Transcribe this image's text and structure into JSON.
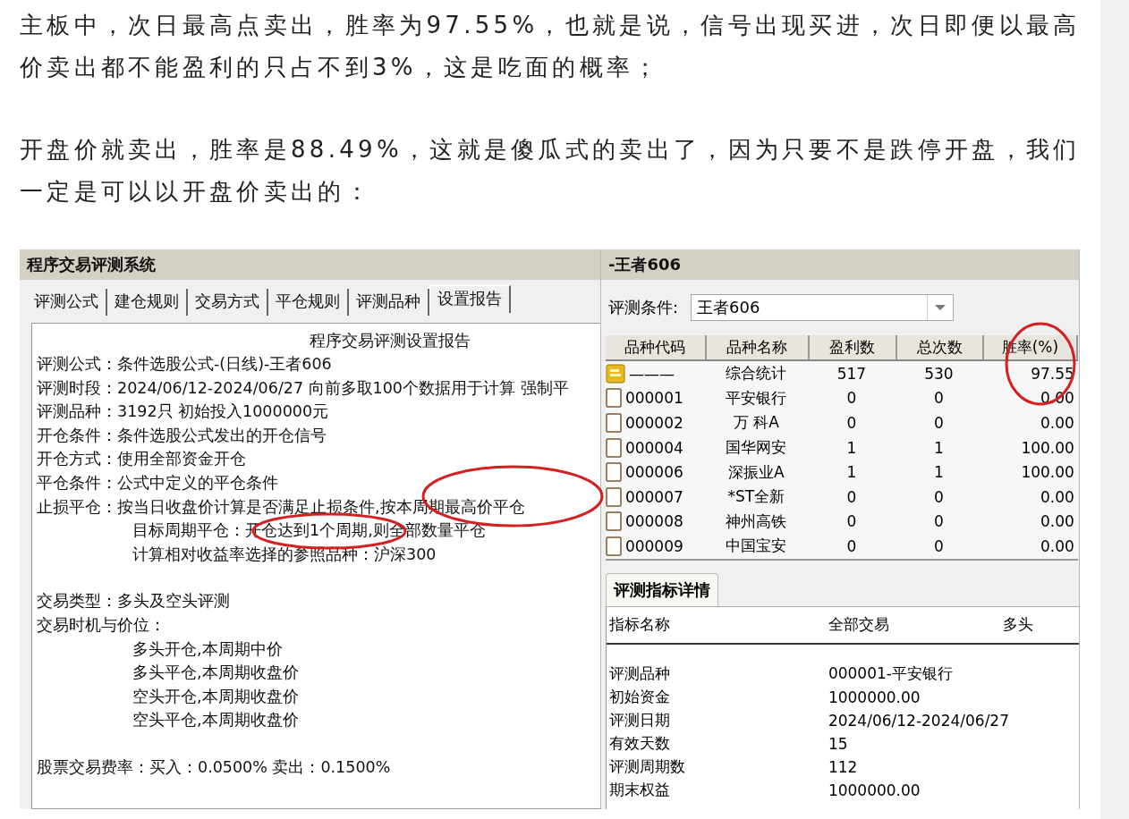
{
  "article": {
    "paragraphs": [
      "主板中，次日最高点卖出，胜率为97.55%，也就是说，信号出现买进，次日即便以最高价卖出都不能盈利的只占不到3%，这是吃面的概率；",
      "开盘价就卖出，胜率是88.49%，这就是傻瓜式的卖出了，因为只要不是跌停开盘，我们一定是可以以开盘价卖出的："
    ]
  },
  "left_window": {
    "title": "程序交易评测系统",
    "tabs": [
      {
        "label": "评测公式",
        "selected": false
      },
      {
        "label": "建仓规则",
        "selected": false
      },
      {
        "label": "交易方式",
        "selected": false
      },
      {
        "label": "平仓规则",
        "selected": false
      },
      {
        "label": "评测品种",
        "selected": false
      },
      {
        "label": "设置报告",
        "selected": true
      }
    ],
    "report": {
      "title": "程序交易评测设置报告",
      "sections": [
        [
          {
            "kind": "plain",
            "text": "评测公式：条件选股公式-(日线)-王者606"
          },
          {
            "kind": "plain",
            "text": "评测时段：2024/06/12-2024/06/27 向前多取100个数据用于计算 强制平"
          },
          {
            "kind": "plain",
            "text": "评测品种：3192只 初始投入1000000元"
          },
          {
            "kind": "plain",
            "text": "开仓条件：条件选股公式发出的开仓信号"
          },
          {
            "kind": "plain",
            "text": "开仓方式：使用全部资金开仓"
          },
          {
            "kind": "plain",
            "text": "平仓条件：公式中定义的平仓条件"
          },
          {
            "kind": "plain",
            "text": "止损平仓：按当日收盘价计算是否满足止损条件,按本周期最高价平仓"
          },
          {
            "kind": "indented",
            "text": "目标周期平仓：开仓达到1个周期,则全部数量平仓"
          },
          {
            "kind": "indented",
            "text": "计算相对收益率选择的参照品种：沪深300"
          }
        ],
        [
          {
            "kind": "plain",
            "text": "交易类型：多头及空头评测"
          },
          {
            "kind": "plain",
            "text": "交易时机与价位："
          },
          {
            "kind": "indented",
            "text": "多头开仓,本周期中价"
          },
          {
            "kind": "indented",
            "text": "多头平仓,本周期收盘价"
          },
          {
            "kind": "indented",
            "text": "空头开仓,本周期收盘价"
          },
          {
            "kind": "indented",
            "text": "空头平仓,本周期收盘价"
          }
        ],
        [
          {
            "kind": "plain",
            "text": "股票交易费率：买入：0.0500%  卖出：0.1500%"
          }
        ]
      ]
    }
  },
  "right_window": {
    "title": "-王者606",
    "condition_label": "评测条件:",
    "condition_value": "王者606",
    "columns": [
      "品种代码",
      "品种名称",
      "盈利数",
      "总次数",
      "胜率(%)"
    ],
    "rows": [
      {
        "kind": "summary",
        "cells": [
          "———",
          "综合统计",
          "517",
          "530",
          "97.55"
        ]
      },
      {
        "kind": "stock",
        "cells": [
          "000001",
          "平安银行",
          "0",
          "0",
          "0.00"
        ]
      },
      {
        "kind": "stock",
        "cells": [
          "000002",
          "万 科A",
          "0",
          "0",
          "0.00"
        ]
      },
      {
        "kind": "stock",
        "cells": [
          "000004",
          "国华网安",
          "1",
          "1",
          "100.00"
        ]
      },
      {
        "kind": "stock",
        "cells": [
          "000006",
          "深振业A",
          "1",
          "1",
          "100.00"
        ]
      },
      {
        "kind": "stock",
        "cells": [
          "000007",
          "*ST全新",
          "0",
          "0",
          "0.00"
        ]
      },
      {
        "kind": "stock",
        "cells": [
          "000008",
          "神州高铁",
          "0",
          "0",
          "0.00"
        ]
      },
      {
        "kind": "stock",
        "cells": [
          "000009",
          "中国宝安",
          "0",
          "0",
          "0.00"
        ]
      }
    ],
    "detail_tab": "评测指标详情",
    "detail_columns": [
      "指标名称",
      "全部交易",
      "多头"
    ],
    "detail_rows": [
      [
        "评测品种",
        "000001-平安银行"
      ],
      [
        "初始资金",
        "1000000.00"
      ],
      [
        "评测日期",
        "2024/06/12-2024/06/27"
      ],
      [
        "有效天数",
        "15"
      ],
      [
        "评测周期数",
        "112"
      ],
      [
        "期末权益",
        "1000000.00"
      ]
    ]
  }
}
